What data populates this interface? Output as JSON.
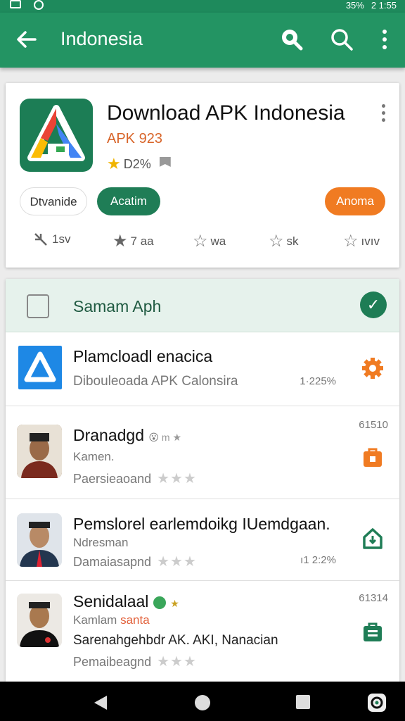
{
  "status_bar": {
    "battery": "35%",
    "time": "2 1:55"
  },
  "app_bar": {
    "title": "Indonesia",
    "back_icon": "arrow-left-icon",
    "icons": [
      "search-badge-icon",
      "search-icon",
      "more-vert-icon"
    ]
  },
  "featured": {
    "title": "Download APK Indonesia",
    "subtitle": "APK 923",
    "rating": "D2%",
    "buttons": {
      "outline": "Dtvanide",
      "green": "Acatim",
      "orange": "Anoma"
    },
    "stats": [
      {
        "icon": "sparkle-icon",
        "label": "1sv"
      },
      {
        "icon": "star-filled-icon",
        "label": "7 aa"
      },
      {
        "icon": "star-outline-icon",
        "label": "wa"
      },
      {
        "icon": "star-outline-icon",
        "label": "sk"
      },
      {
        "icon": "star-outline-icon",
        "label": "ıvıv"
      }
    ]
  },
  "section": {
    "label": "Samam Aph"
  },
  "items": [
    {
      "title": "Plamcloadl enacica",
      "line2": "Dibouleoada APK Calonsira",
      "num": "1·225%"
    },
    {
      "title": "Dranadgd",
      "badge": "m ★",
      "line2": "Kamen.",
      "line3": "Paersieaoand",
      "num": "61510"
    },
    {
      "title": "Pemslorel earlemdoikg IUemdgaan.",
      "line2": "Ndresman",
      "line3": "Damaiasapnd",
      "num": "ı1 2:2%"
    },
    {
      "title": "Senidalaal",
      "badge": "★",
      "line2": "Kamlam",
      "line2b": "santa",
      "line3": "Sarenahgehbdr AK. AKI, Nanacian",
      "line4": "Pemaibeagnd",
      "num": "61314"
    }
  ],
  "colors": {
    "primary": "#239463",
    "accent": "#f07b22",
    "dark_green": "#1f7d56"
  }
}
